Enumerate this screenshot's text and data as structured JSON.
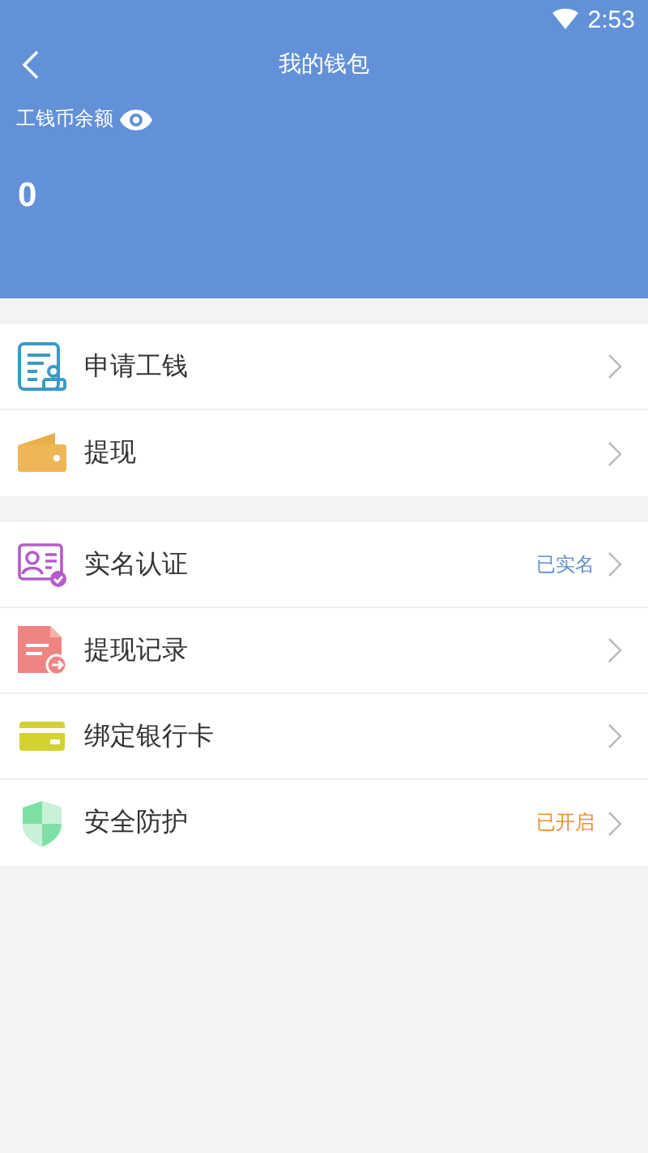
{
  "status_bar": {
    "time": "2:53"
  },
  "header": {
    "title": "我的钱包",
    "balance_label": "工钱币余额",
    "balance": "0"
  },
  "groups": [
    {
      "items": [
        {
          "kind": "apply",
          "label": "申请工钱"
        },
        {
          "kind": "wallet",
          "label": "提现"
        }
      ]
    },
    {
      "items": [
        {
          "kind": "idcard",
          "label": "实名认证",
          "status": "已实名",
          "color": "#5b8fd0"
        },
        {
          "kind": "record",
          "label": "提现记录"
        },
        {
          "kind": "card",
          "label": "绑定银行卡"
        },
        {
          "kind": "shield",
          "label": "安全防护",
          "status": "已开启",
          "color": "#e8902a"
        }
      ]
    }
  ]
}
